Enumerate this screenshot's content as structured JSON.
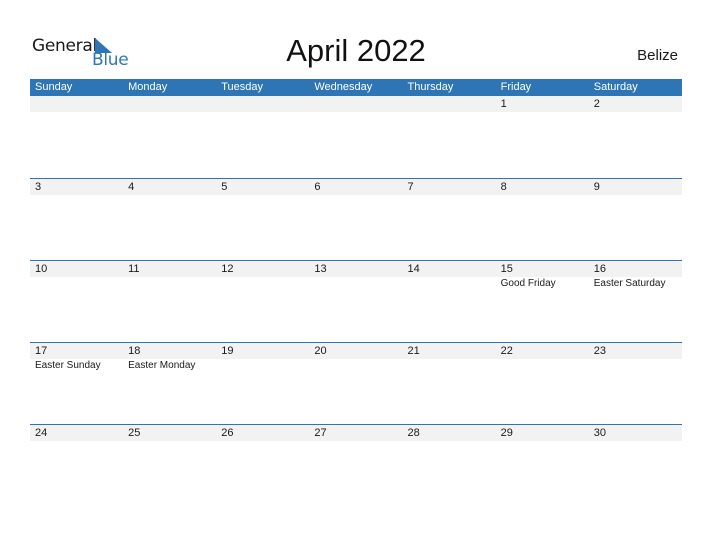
{
  "logo": {
    "general": "General",
    "blue": "Blue"
  },
  "title": "April 2022",
  "country": "Belize",
  "colors": {
    "accent": "#2e75b6",
    "strip": "#f2f2f2"
  },
  "weekdays": [
    "Sunday",
    "Monday",
    "Tuesday",
    "Wednesday",
    "Thursday",
    "Friday",
    "Saturday"
  ],
  "weeks": [
    {
      "days": [
        "",
        "",
        "",
        "",
        "",
        "1",
        "2"
      ],
      "events": [
        "",
        "",
        "",
        "",
        "",
        "",
        ""
      ]
    },
    {
      "days": [
        "3",
        "4",
        "5",
        "6",
        "7",
        "8",
        "9"
      ],
      "events": [
        "",
        "",
        "",
        "",
        "",
        "",
        ""
      ]
    },
    {
      "days": [
        "10",
        "11",
        "12",
        "13",
        "14",
        "15",
        "16"
      ],
      "events": [
        "",
        "",
        "",
        "",
        "",
        "Good Friday",
        "Easter Saturday"
      ]
    },
    {
      "days": [
        "17",
        "18",
        "19",
        "20",
        "21",
        "22",
        "23"
      ],
      "events": [
        "Easter Sunday",
        "Easter Monday",
        "",
        "",
        "",
        "",
        ""
      ]
    },
    {
      "days": [
        "24",
        "25",
        "26",
        "27",
        "28",
        "29",
        "30"
      ],
      "events": [
        "",
        "",
        "",
        "",
        "",
        "",
        ""
      ]
    }
  ]
}
